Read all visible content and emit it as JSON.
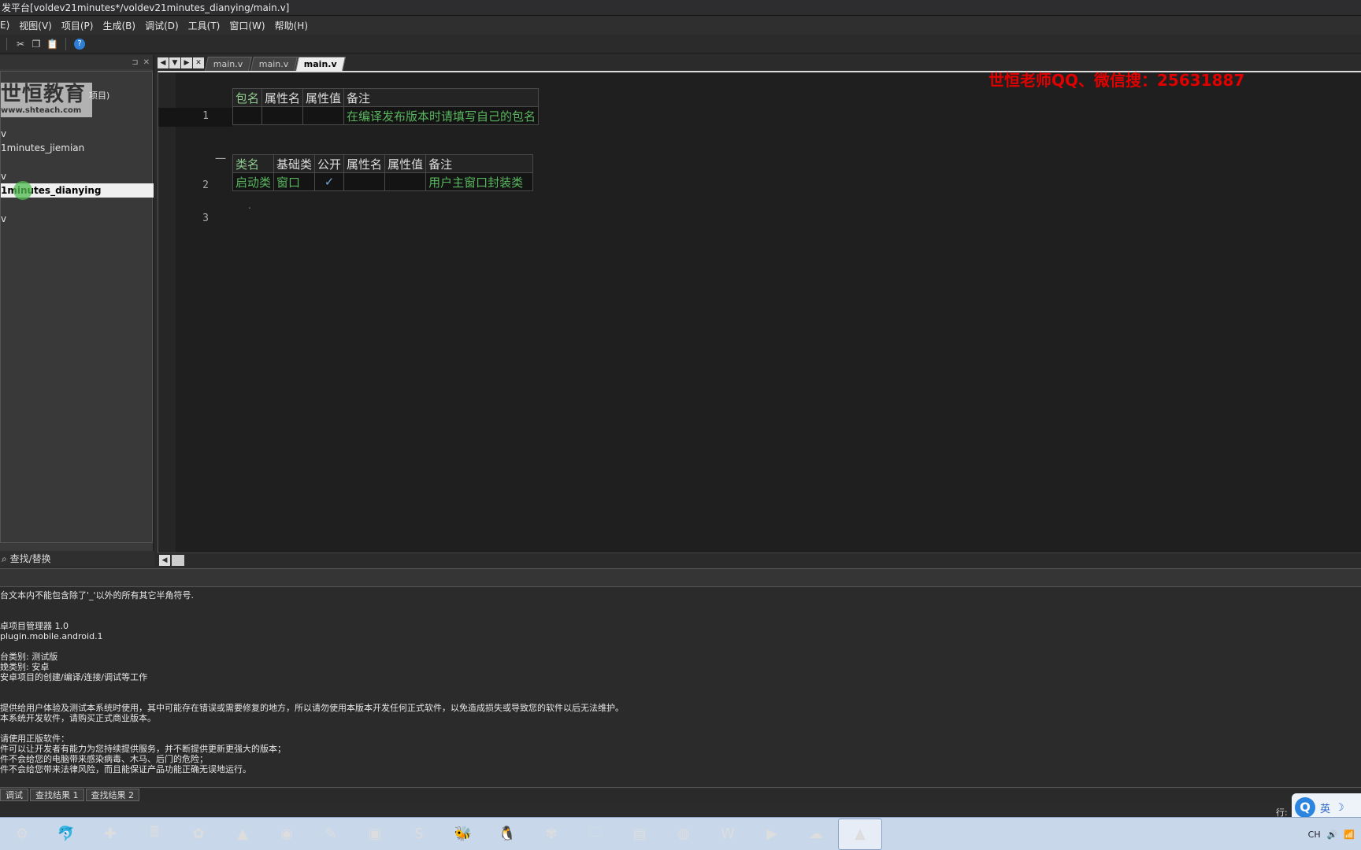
{
  "window": {
    "title": "发平台[voldev21minutes*/voldev21minutes_dianying/main.v]"
  },
  "menu": [
    "E)",
    "视图(V)",
    "项目(P)",
    "生成(B)",
    "调试(D)",
    "工具(T)",
    "窗口(W)",
    "帮助(H)"
  ],
  "left_panel": {
    "logo_main": "世恒教育",
    "logo_sub": "www.shteach.com",
    "logo_tail": "项目)",
    "items": [
      "v",
      "1minutes_jiemian",
      "v",
      "1minutes_dianying",
      "v"
    ],
    "selected_index": 3,
    "footer": "查找/替换"
  },
  "tabs": [
    "main.v",
    "main.v",
    "main.v"
  ],
  "active_tab": 2,
  "editor": {
    "watermark": "世恒老师QQ、微信搜：25631887",
    "line_numbers": [
      "1",
      "2",
      "3"
    ],
    "collapse_symbol": "一",
    "dot": ".",
    "table1": {
      "headers": [
        "包名",
        "属性名",
        "属性值",
        "备注"
      ],
      "row": [
        "",
        "",
        "",
        "在编译发布版本时请填写自己的包名"
      ]
    },
    "table2": {
      "headers": [
        "类名",
        "基础类",
        "公开",
        "属性名",
        "属性值",
        "备注"
      ],
      "row": [
        "启动类",
        "窗口",
        "✓",
        "",
        "",
        "用户主窗口封装类"
      ]
    }
  },
  "output": {
    "lines": [
      "台文本内不能包含除了'_'以外的所有其它半角符号.",
      "",
      "",
      "卓项目管理器 1.0",
      "plugin.mobile.android.1",
      "",
      "台类别: 测试版",
      "娩类别: 安卓",
      "安卓项目的创建/编译/连接/调试等工作",
      "",
      "",
      "提供给用户体验及测试本系统时使用，其中可能存在错误或需要修复的地方，所以请勿使用本版本开发任何正式软件，以免造成损失或导致您的软件以后无法维护。",
      "本系统开发软件，请购买正式商业版本。",
      "",
      "",
      "请使用正版软件：",
      "件可以让开发者有能力为您持续提供服务，并不断提供更新更强大的版本；",
      "件不会给您的电脑带来感染病毒、木马、后门的危险；",
      "件不会给您带来法律风险，而且能保证产品功能正确无误地运行。"
    ]
  },
  "bottom_tabs": [
    "调试",
    "查找结果 1",
    "查找结果 2"
  ],
  "status": {
    "row_label": "行:"
  },
  "ime": {
    "q": "Q",
    "lang": "英",
    "moon": "☽"
  },
  "taskbar": {
    "apps": [
      "⚙",
      "🐬",
      "✚",
      "🖩",
      "✿",
      "▲",
      "◉",
      "✎",
      "▣",
      "S",
      "🐝",
      "🐧",
      "✾",
      "🗀",
      "▤",
      "◍",
      "W",
      "▶",
      "☁",
      "▲"
    ],
    "active_index": 19,
    "tray_text": "CH"
  }
}
